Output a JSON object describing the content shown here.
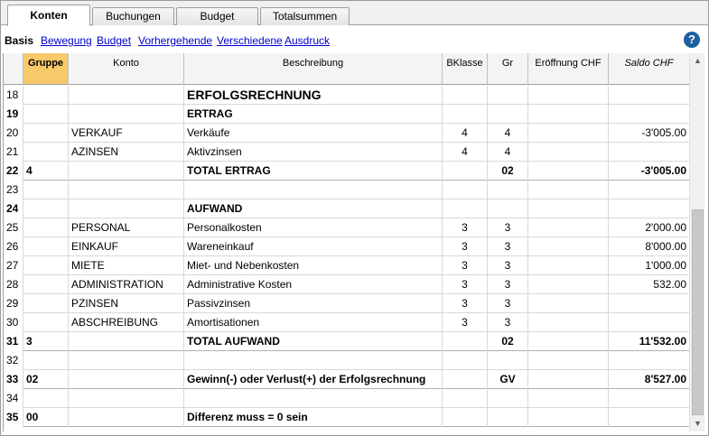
{
  "tabs": [
    {
      "label": "Konten",
      "active": true
    },
    {
      "label": "Buchungen",
      "active": false
    },
    {
      "label": "Budget",
      "active": false
    },
    {
      "label": "Totalsummen",
      "active": false
    }
  ],
  "views": {
    "current": "Basis",
    "links": [
      "Bewegung",
      "Budget",
      "Vorhergehende",
      "Verschiedene",
      "Ausdruck"
    ]
  },
  "help_icon": "question-circle-icon",
  "columns": [
    "",
    "Gruppe",
    "Konto",
    "Beschreibung",
    "BKlasse",
    "Gr",
    "Eröffnung CHF",
    "Saldo CHF"
  ],
  "rows": [
    {
      "n": "18",
      "gruppe": "",
      "konto": "",
      "beschreibung": "ERFOLGSRECHNUNG",
      "bklasse": "",
      "gr": "",
      "eroeffnung": "",
      "saldo": "",
      "style": "title"
    },
    {
      "n": "19",
      "gruppe": "",
      "konto": "",
      "beschreibung": "ERTRAG",
      "bklasse": "",
      "gr": "",
      "eroeffnung": "",
      "saldo": "",
      "style": "section"
    },
    {
      "n": "20",
      "gruppe": "",
      "konto": "VERKAUF",
      "beschreibung": "Verkäufe",
      "bklasse": "4",
      "gr": "4",
      "eroeffnung": "",
      "saldo": "-3'005.00",
      "style": "normal"
    },
    {
      "n": "21",
      "gruppe": "",
      "konto": "AZINSEN",
      "beschreibung": "Aktivzinsen",
      "bklasse": "4",
      "gr": "4",
      "eroeffnung": "",
      "saldo": "",
      "style": "normal"
    },
    {
      "n": "22",
      "gruppe": "4",
      "konto": "",
      "beschreibung": "TOTAL ERTRAG",
      "bklasse": "",
      "gr": "02",
      "eroeffnung": "",
      "saldo": "-3'005.00",
      "style": "total"
    },
    {
      "n": "23",
      "gruppe": "",
      "konto": "",
      "beschreibung": "",
      "bklasse": "",
      "gr": "",
      "eroeffnung": "",
      "saldo": "",
      "style": "normal"
    },
    {
      "n": "24",
      "gruppe": "",
      "konto": "",
      "beschreibung": "AUFWAND",
      "bklasse": "",
      "gr": "",
      "eroeffnung": "",
      "saldo": "",
      "style": "section"
    },
    {
      "n": "25",
      "gruppe": "",
      "konto": "PERSONAL",
      "beschreibung": "Personalkosten",
      "bklasse": "3",
      "gr": "3",
      "eroeffnung": "",
      "saldo": "2'000.00",
      "style": "normal"
    },
    {
      "n": "26",
      "gruppe": "",
      "konto": "EINKAUF",
      "beschreibung": "Wareneinkauf",
      "bklasse": "3",
      "gr": "3",
      "eroeffnung": "",
      "saldo": "8'000.00",
      "style": "normal"
    },
    {
      "n": "27",
      "gruppe": "",
      "konto": "MIETE",
      "beschreibung": "Miet- und Nebenkosten",
      "bklasse": "3",
      "gr": "3",
      "eroeffnung": "",
      "saldo": "1'000.00",
      "style": "normal"
    },
    {
      "n": "28",
      "gruppe": "",
      "konto": "ADMINISTRATION",
      "beschreibung": "Administrative Kosten",
      "bklasse": "3",
      "gr": "3",
      "eroeffnung": "",
      "saldo": "532.00",
      "style": "normal"
    },
    {
      "n": "29",
      "gruppe": "",
      "konto": "PZINSEN",
      "beschreibung": "Passivzinsen",
      "bklasse": "3",
      "gr": "3",
      "eroeffnung": "",
      "saldo": "",
      "style": "normal"
    },
    {
      "n": "30",
      "gruppe": "",
      "konto": "ABSCHREIBUNG",
      "beschreibung": "Amortisationen",
      "bklasse": "3",
      "gr": "3",
      "eroeffnung": "",
      "saldo": "",
      "style": "normal"
    },
    {
      "n": "31",
      "gruppe": "3",
      "konto": "",
      "beschreibung": "TOTAL AUFWAND",
      "bklasse": "",
      "gr": "02",
      "eroeffnung": "",
      "saldo": "11'532.00",
      "style": "total"
    },
    {
      "n": "32",
      "gruppe": "",
      "konto": "",
      "beschreibung": "",
      "bklasse": "",
      "gr": "",
      "eroeffnung": "",
      "saldo": "",
      "style": "normal"
    },
    {
      "n": "33",
      "gruppe": "02",
      "konto": "",
      "beschreibung": "Gewinn(-) oder Verlust(+) der Erfolgsrechnung",
      "bklasse": "",
      "gr": "GV",
      "eroeffnung": "",
      "saldo": "8'527.00",
      "style": "total"
    },
    {
      "n": "34",
      "gruppe": "",
      "konto": "",
      "beschreibung": "",
      "bklasse": "",
      "gr": "",
      "eroeffnung": "",
      "saldo": "",
      "style": "normal"
    },
    {
      "n": "35",
      "gruppe": "00",
      "konto": "",
      "beschreibung": "Differenz muss = 0 sein",
      "bklasse": "",
      "gr": "",
      "eroeffnung": "",
      "saldo": "",
      "style": "total"
    }
  ],
  "scrollbar": {
    "up_icon": "arrow-up-icon",
    "down_icon": "arrow-down-icon"
  }
}
